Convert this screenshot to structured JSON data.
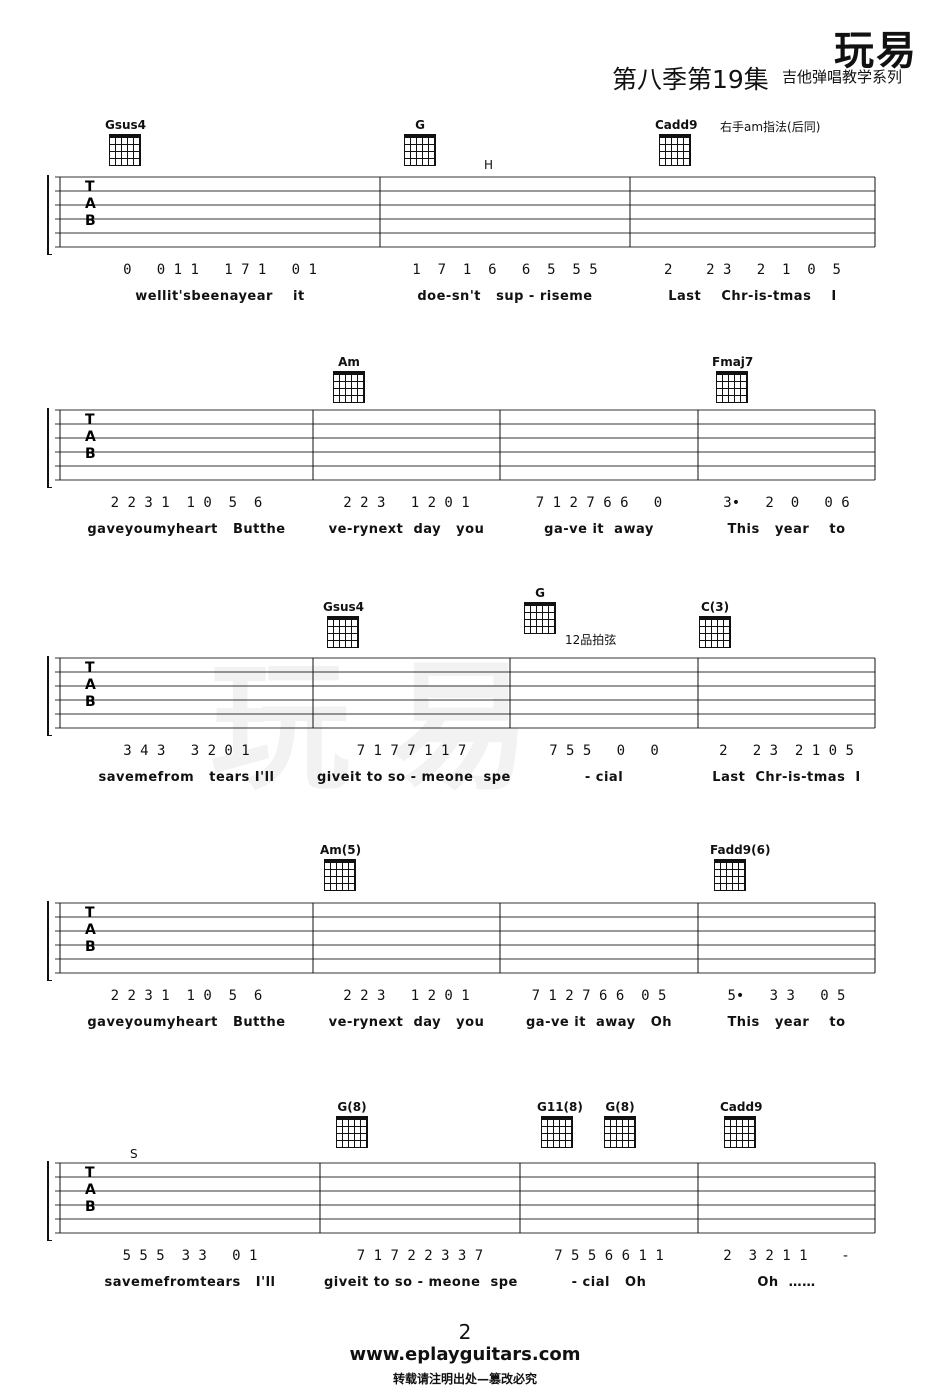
{
  "header": {
    "logo": "玩易",
    "season": "第八季第19集",
    "series": "吉他弹唱教学系列"
  },
  "watermark": "玩易",
  "systems": [
    {
      "chords": [
        "Gsus4",
        "G",
        "Cadd9"
      ],
      "annotations": [
        "右手am指法(后同)",
        "H"
      ],
      "measures": [
        {
          "notes": "0   0 1 1   1 7 1   0 1",
          "lyrics": "wellit'sbeenayear    it"
        },
        {
          "notes": "1  7  1  6   6  5  5 5",
          "lyrics": "doe-sn't   sup - riseme"
        },
        {
          "notes": "2    2 3   2  1  0  5",
          "lyrics": "Last    Chr-is-tmas    I"
        }
      ]
    },
    {
      "chords": [
        "Am",
        "Fmaj7"
      ],
      "annotations": [],
      "measures": [
        {
          "notes": "2 2 3 1  1 0  5  6",
          "lyrics": "gaveyoumyheart   Butthe"
        },
        {
          "notes": "2 2 3   1 2 0 1",
          "lyrics": "ve-rynext  day   you"
        },
        {
          "notes": "7 1 2 7 6 6   0",
          "lyrics": "ga-ve it  away"
        },
        {
          "notes": "3•   2  0   0 6",
          "lyrics": "This   year    to"
        }
      ]
    },
    {
      "chords": [
        "Gsus4",
        "G",
        "C(3)"
      ],
      "annotations": [
        "12品拍弦"
      ],
      "measures": [
        {
          "notes": "3 4 3   3 2 0 1",
          "lyrics": "savemefrom   tears I'll"
        },
        {
          "notes": "7 1 7 7 1 1 7",
          "lyrics": "giveit to so - meone  spe"
        },
        {
          "notes": "7 5 5   0   0",
          "lyrics": "- cial"
        },
        {
          "notes": "2   2 3  2 1 0 5",
          "lyrics": "Last  Chr-is-tmas  I"
        }
      ]
    },
    {
      "chords": [
        "Am(5)",
        "Fadd9(6)"
      ],
      "annotations": [],
      "measures": [
        {
          "notes": "2 2 3 1  1 0  5  6",
          "lyrics": "gaveyoumyheart   Butthe"
        },
        {
          "notes": "2 2 3   1 2 0 1",
          "lyrics": "ve-rynext  day   you"
        },
        {
          "notes": "7 1 2 7 6 6  0 5",
          "lyrics": "ga-ve it  away   Oh"
        },
        {
          "notes": "5•   3 3   0 5",
          "lyrics": "This   year    to"
        }
      ]
    },
    {
      "chords": [
        "G(8)",
        "G11(8)",
        "G(8)",
        "Cadd9"
      ],
      "annotations": [
        "S"
      ],
      "measures": [
        {
          "notes": "5 5 5  3 3   0 1",
          "lyrics": "savemefromtears   I'll"
        },
        {
          "notes": "7 1 7 2 2 3 3 7",
          "lyrics": "giveit to so - meone  spe"
        },
        {
          "notes": "7 5 5 6 6 1 1",
          "lyrics": "- cial   Oh"
        },
        {
          "notes": "2  3 2 1 1    -",
          "lyrics": "Oh  ……"
        }
      ]
    }
  ],
  "tab_letters": [
    "T",
    "A",
    "B"
  ],
  "footer": {
    "page": "2",
    "url": "www.eplayguitars.com",
    "notice": "转载请注明出处—篡改必究"
  }
}
